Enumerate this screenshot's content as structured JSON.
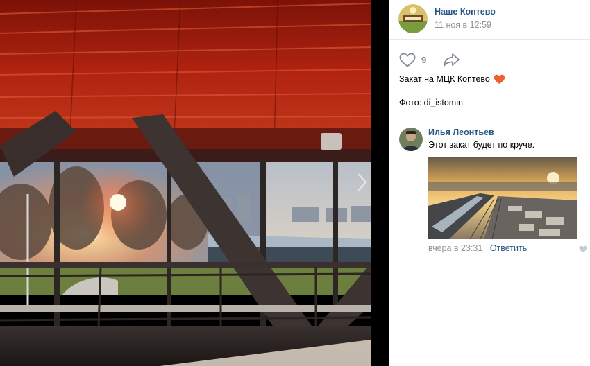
{
  "photo": {
    "description_icon": "photo-icon",
    "next_icon": "chevron-right-icon"
  },
  "post": {
    "group_name": "Наше Коптево",
    "avatar_icon": "group-avatar",
    "date": "11 ноя в 12:59",
    "likes": {
      "icon": "heart-icon",
      "count": "9"
    },
    "share_icon": "share-icon",
    "caption": "Закат на МЦК Коптево",
    "caption_emoji": "heart-emoji-icon",
    "credit": "Фото: di_istomin"
  },
  "comments": [
    {
      "author": "Илья Леонтьев",
      "text": "Этот закат будет по круче.",
      "time": "вчера в 23:31",
      "reply_label": "Ответить",
      "like_icon": "heart-icon"
    }
  ],
  "colors": {
    "link": "#2a5885",
    "muted": "#939393",
    "divider": "#e7e8ec",
    "emoji": "#e8632f"
  }
}
